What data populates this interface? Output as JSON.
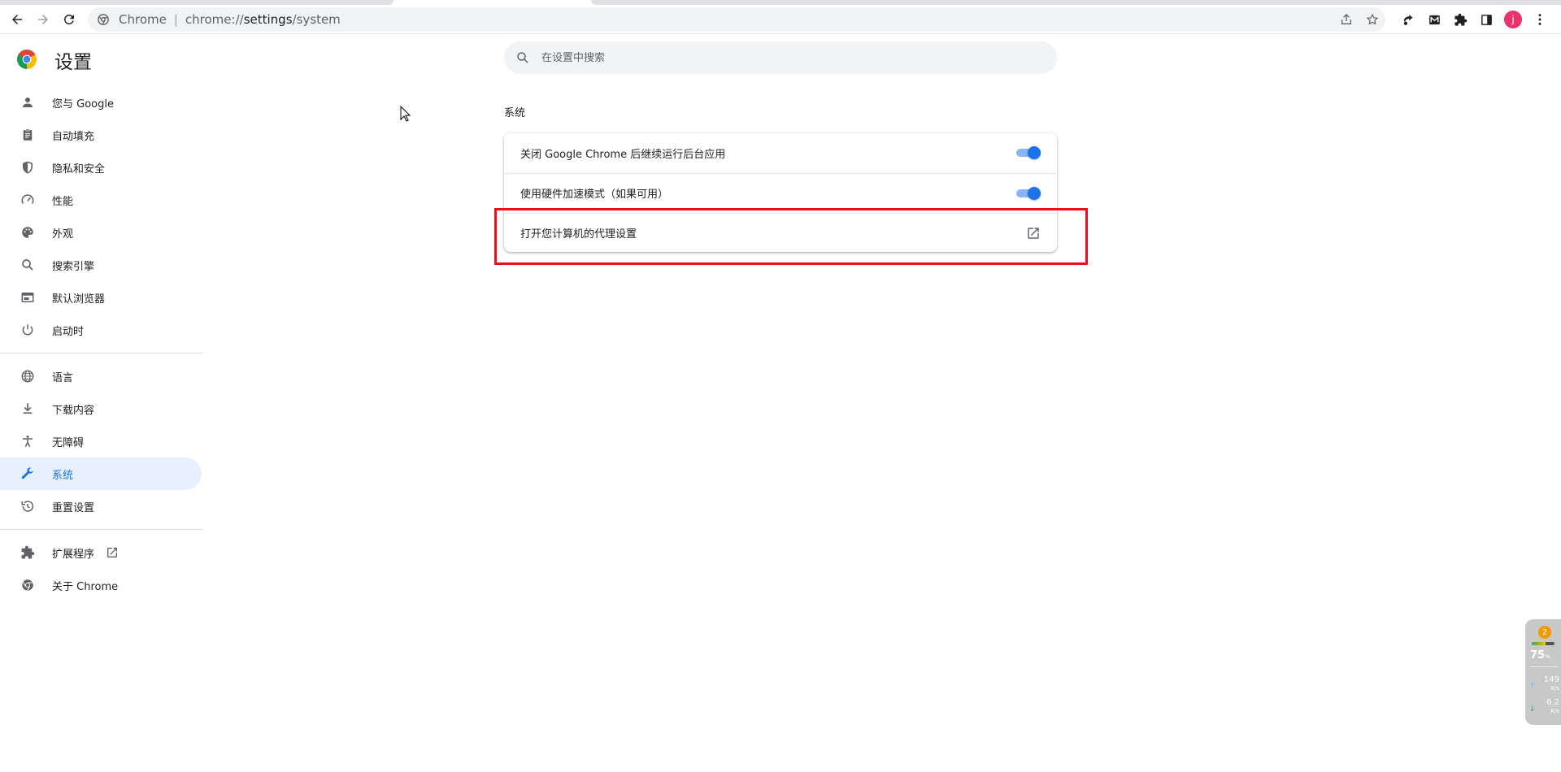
{
  "browser": {
    "site_name": "Chrome",
    "url_scheme": "chrome://",
    "url_host": "settings",
    "url_path": "/system"
  },
  "settings": {
    "title": "设置",
    "search_placeholder": "在设置中搜索"
  },
  "sidebar": {
    "items": [
      {
        "label": "您与 Google",
        "icon": "person-icon"
      },
      {
        "label": "自动填充",
        "icon": "clipboard-icon"
      },
      {
        "label": "隐私和安全",
        "icon": "shield-icon"
      },
      {
        "label": "性能",
        "icon": "speedometer-icon"
      },
      {
        "label": "外观",
        "icon": "palette-icon"
      },
      {
        "label": "搜索引擎",
        "icon": "search-icon"
      },
      {
        "label": "默认浏览器",
        "icon": "browser-window-icon"
      },
      {
        "label": "启动时",
        "icon": "power-icon"
      },
      {
        "label": "语言",
        "icon": "globe-icon"
      },
      {
        "label": "下载内容",
        "icon": "download-icon"
      },
      {
        "label": "无障碍",
        "icon": "accessibility-icon"
      },
      {
        "label": "系统",
        "icon": "wrench-icon"
      },
      {
        "label": "重置设置",
        "icon": "history-icon"
      },
      {
        "label": "扩展程序",
        "icon": "puzzle-icon"
      },
      {
        "label": "关于 Chrome",
        "icon": "chrome-icon"
      }
    ],
    "active": "系统"
  },
  "system": {
    "section_title": "系统",
    "rows": [
      {
        "label": "关闭 Google Chrome 后继续运行后台应用",
        "control": "toggle",
        "enabled": true
      },
      {
        "label": "使用硬件加速模式（如果可用）",
        "control": "toggle",
        "enabled": true
      },
      {
        "label": "打开您计算机的代理设置",
        "control": "external-link"
      }
    ]
  },
  "widget": {
    "badge": "2",
    "percent": "75",
    "percent_unit": "%",
    "upload": "149",
    "upload_unit": "K/s",
    "download": "6.2",
    "download_unit": "K/s"
  },
  "colors": {
    "accent": "#1a73e8",
    "active_bg": "#e8f0fe",
    "highlight": "#e8101a"
  }
}
